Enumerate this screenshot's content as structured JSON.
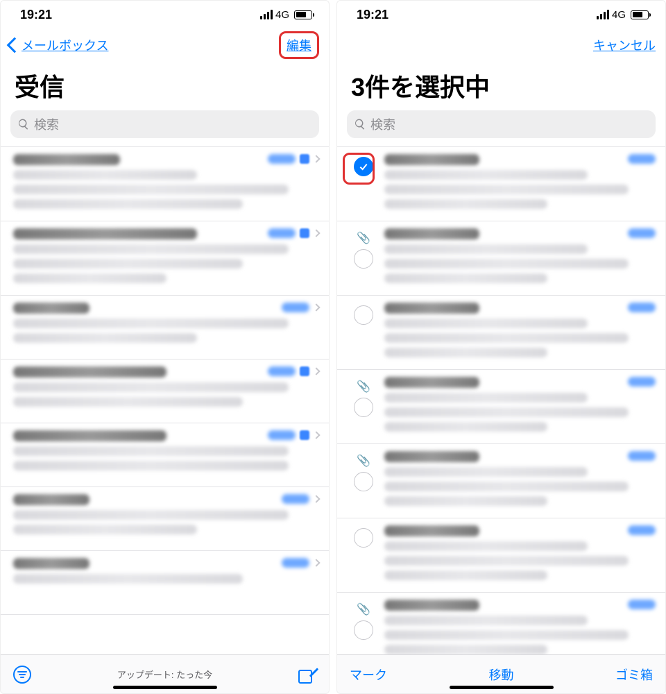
{
  "status": {
    "time": "19:21",
    "network": "4G"
  },
  "left": {
    "nav_back": "メールボックス",
    "nav_edit": "編集",
    "title": "受信",
    "search_placeholder": "検索",
    "toolbar_status": "アップデート: たった今"
  },
  "right": {
    "nav_cancel": "キャンセル",
    "title": "3件を選択中",
    "search_placeholder": "検索",
    "toolbar": {
      "mark": "マーク",
      "move": "移動",
      "trash": "ゴミ箱"
    },
    "rows": [
      {
        "selected": true,
        "has_attachment": false
      },
      {
        "selected": false,
        "has_attachment": true
      },
      {
        "selected": false,
        "has_attachment": false
      },
      {
        "selected": false,
        "has_attachment": true
      },
      {
        "selected": false,
        "has_attachment": true
      },
      {
        "selected": false,
        "has_attachment": false
      },
      {
        "selected": false,
        "has_attachment": true
      }
    ]
  }
}
